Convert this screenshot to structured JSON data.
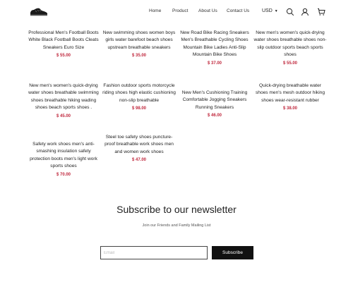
{
  "header": {
    "nav": [
      "Home",
      "Product",
      "About Us",
      "Contact Us"
    ],
    "currency": "USD",
    "icons": [
      "search-icon",
      "account-icon",
      "cart-icon"
    ]
  },
  "products": [
    {
      "title": "Professional Men's Football Boots White Black Football Boots Cleats Sneakers Euro Size",
      "price": "$ 55.00"
    },
    {
      "title": "New swimming shoes women boys girls water barefoot beach shoes upstream breathable sneakers",
      "price": "$ 35.00"
    },
    {
      "title": "New Road Bike Racing Sneakers Men's Breathable Cycling Shoes Mountain Bike Ladies Anti-Slip Mountain Bike Shoes",
      "price": "$ 37.00"
    },
    {
      "title": "New men's women's quick-drying water shoes breathable shoes non-slip outdoor sports beach sports shoes",
      "price": "$ 55.00"
    },
    {
      "title": "New men's women's quick-drying water shoes breathable swimming shoes breathable hiking wading shoes beach sports shoes .",
      "price": "$ 45.00"
    },
    {
      "title": "Fashion outdoor sports motorcycle riding shoes high elastic cushioning non-slip breathable",
      "price": "$ 98.00"
    },
    {
      "title": "New Men's Cushioning Training Comfortable Jogging Sneakers Running Sneakers",
      "price": "$ 46.00"
    },
    {
      "title": "Quick-drying breathable water shoes men's mesh outdoor hiking shoes wear-resistant rubber",
      "price": "$ 38.00"
    },
    {
      "title": "Safety work shoes men's anti-smashing insulation safety protection boots men's light work sports shoes",
      "price": "$ 70.00"
    },
    {
      "title": "Steel toe safety shoes puncture-proof breathable work shoes men and women work shoes",
      "price": "$ 47.00"
    }
  ],
  "newsletter": {
    "title": "Subscribe to our newsletter",
    "subtitle": "Join our Friends and Family Mailing List",
    "email_placeholder": "Email",
    "button_label": "Subscribe"
  },
  "colors": {
    "price": "#c0283d",
    "button": "#111111"
  }
}
